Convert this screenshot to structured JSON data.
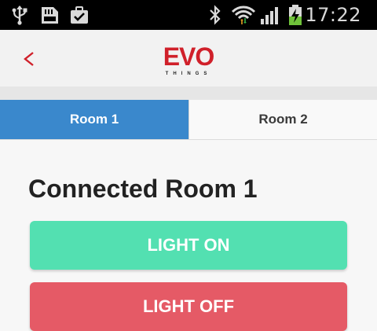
{
  "status_bar": {
    "time": "17:22",
    "icons": [
      "usb-icon",
      "sd-card-icon",
      "briefcase-check-icon",
      "bluetooth-icon",
      "wifi-icon",
      "signal-icon",
      "battery-charging-icon"
    ]
  },
  "header": {
    "back_icon": "chevron-left-icon",
    "logo_main": "EVO",
    "logo_sub": "THINGS"
  },
  "tabs": [
    {
      "label": "Room 1",
      "active": true
    },
    {
      "label": "Room 2",
      "active": false
    }
  ],
  "main": {
    "title": "Connected Room 1",
    "light_on_label": "LIGHT ON",
    "light_off_label": "LIGHT OFF"
  },
  "colors": {
    "accent_blue": "#3a88cc",
    "on_green": "#53e0b1",
    "off_red": "#e55a66",
    "logo_red": "#d0202a"
  }
}
